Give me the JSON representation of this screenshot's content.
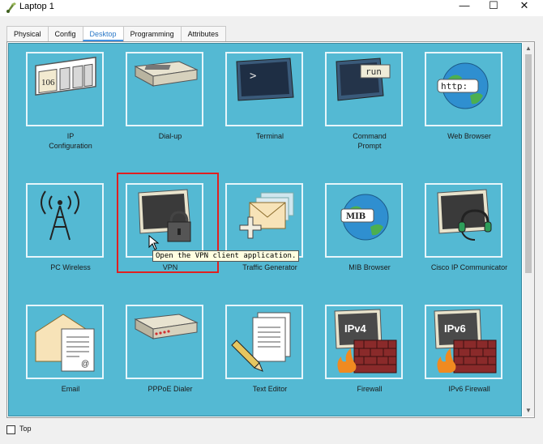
{
  "window": {
    "title": "Laptop 1",
    "minimize": "—",
    "maximize": "☐",
    "close": "✕"
  },
  "tabs": [
    {
      "label": "Physical",
      "active": false
    },
    {
      "label": "Config",
      "active": false
    },
    {
      "label": "Desktop",
      "active": true
    },
    {
      "label": "Programming",
      "active": false
    },
    {
      "label": "Attributes",
      "active": false
    }
  ],
  "apps": [
    {
      "label": "IP\nConfiguration",
      "icon": "ip-config-icon",
      "icon_text": "106"
    },
    {
      "label": "Dial-up",
      "icon": "modem-icon"
    },
    {
      "label": "Terminal",
      "icon": "terminal-icon",
      "icon_text": ">"
    },
    {
      "label": "Command\nPrompt",
      "icon": "command-prompt-icon",
      "icon_text": "run"
    },
    {
      "label": "Web Browser",
      "icon": "globe-icon",
      "icon_text": "http:"
    },
    {
      "label": "PC Wireless",
      "icon": "wireless-tower-icon"
    },
    {
      "label": "VPN",
      "icon": "vpn-lock-icon"
    },
    {
      "label": "Traffic Generator",
      "icon": "traffic-generator-icon"
    },
    {
      "label": "MIB Browser",
      "icon": "mib-globe-icon",
      "icon_text": "MIB"
    },
    {
      "label": "Cisco IP Communicator",
      "icon": "headset-monitor-icon"
    },
    {
      "label": "Email",
      "icon": "email-icon"
    },
    {
      "label": "PPPoE Dialer",
      "icon": "pppoe-dialer-icon"
    },
    {
      "label": "Text Editor",
      "icon": "text-editor-icon"
    },
    {
      "label": "Firewall",
      "icon": "firewall-icon",
      "icon_text": "IPv4"
    },
    {
      "label": "IPv6 Firewall",
      "icon": "ipv6-firewall-icon",
      "icon_text": "IPv6"
    }
  ],
  "tooltip": "Open the VPN client application.",
  "bottom": {
    "top_checkbox_label": "Top",
    "top_checked": false
  },
  "colors": {
    "desktop": "#54b9d3",
    "highlight": "#e02020",
    "active_tab": "#2a78c8"
  }
}
